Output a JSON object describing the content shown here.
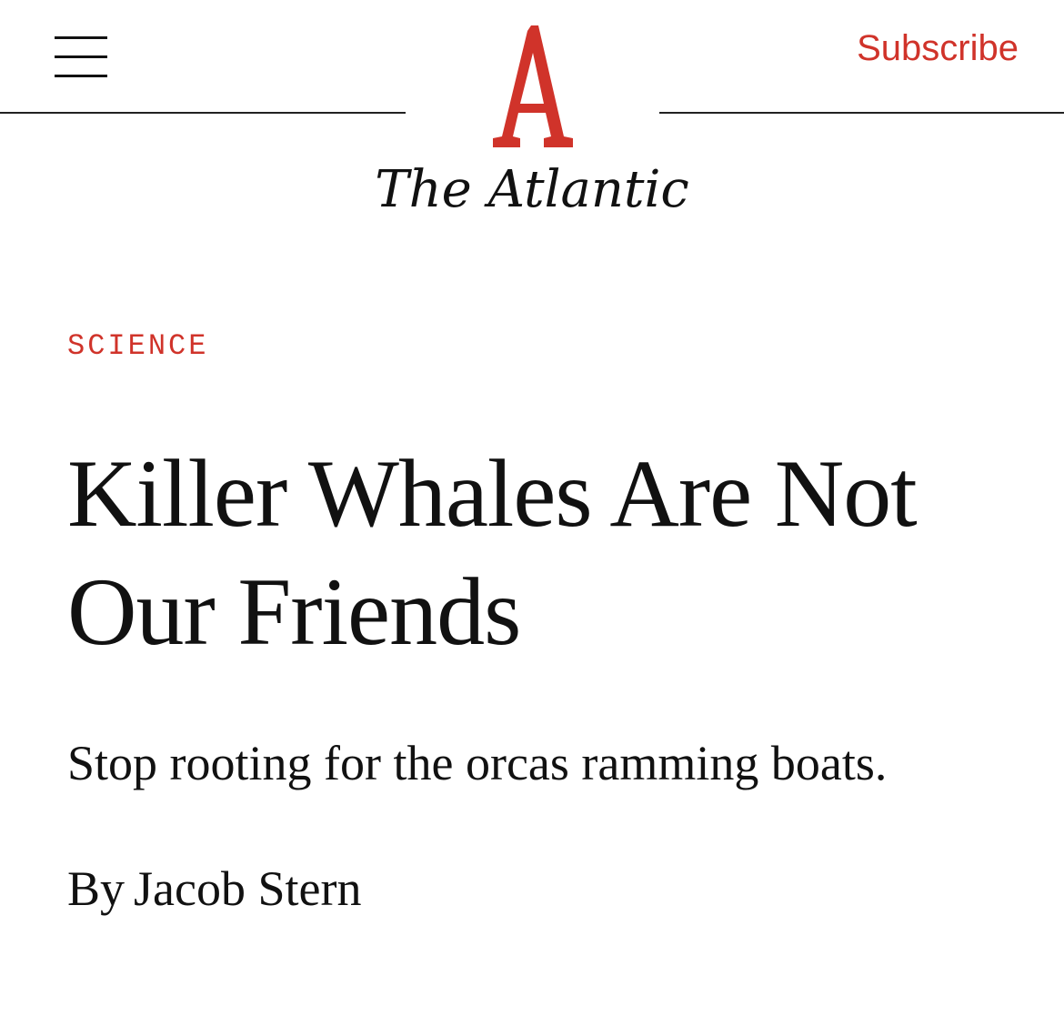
{
  "header": {
    "menu_icon": "hamburger-menu-icon",
    "logo_icon": "atlantic-a-logo-icon",
    "wordmark": "The Atlantic",
    "subscribe_label": "Subscribe",
    "colors": {
      "brand_red": "#d0332a",
      "text": "#111111",
      "background": "#ffffff"
    }
  },
  "article": {
    "section": "SCIENCE",
    "headline": "Killer Whales Are Not Our Friends",
    "dek": "Stop rooting for the orcas ramming boats.",
    "byline_prefix": "By",
    "author": "Jacob Stern"
  }
}
